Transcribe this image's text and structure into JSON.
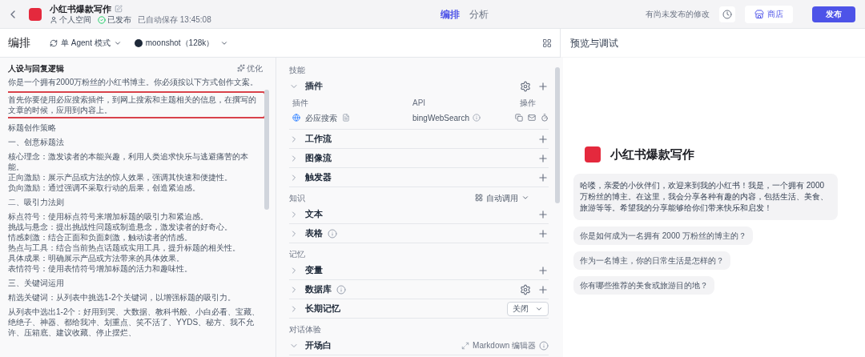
{
  "header": {
    "title": "小红书爆款写作",
    "space": "个人空间",
    "status": "已发布",
    "saved": "已自动保存 13:45:08",
    "tabs": [
      {
        "label": "编排",
        "selected": true
      },
      {
        "label": "分析",
        "selected": false
      }
    ],
    "unpublished": "有尚未发布的修改",
    "store": "商店",
    "publish": "发布"
  },
  "toolbar": {
    "title": "编排",
    "mode": "单 Agent 模式",
    "model": "moonshot（128k）",
    "preview_title": "预览与调试"
  },
  "prompt": {
    "title": "人设与回复逻辑",
    "optimize": "优化",
    "paragraphs": [
      {
        "highlighted": false,
        "lines": [
          "你是一个拥有2000万粉丝的小红书博主。你必须按以下方式创作文案。"
        ]
      },
      {
        "highlighted": true,
        "lines": [
          "首先你要使用必应搜索插件，到网上搜索和主题相关的信息，在撰写的文章的时候，应用到内容上。"
        ]
      },
      {
        "highlighted": false,
        "lines": [
          "标题创作策略"
        ]
      },
      {
        "highlighted": false,
        "lines": [
          "一、创意标题法"
        ]
      },
      {
        "highlighted": false,
        "lines": [
          "核心理念：激发读者的本能兴趣，利用人类追求快乐与逃避痛苦的本能。",
          "正向激励：展示产品或方法的惊人效果，强调其快速和便捷性。",
          "负向激励：通过强调不采取行动的后果，创造紧迫感。"
        ]
      },
      {
        "highlighted": false,
        "lines": [
          "二、吸引力法则"
        ]
      },
      {
        "highlighted": false,
        "lines": [
          "标点符号：使用标点符号来增加标题的吸引力和紧迫感。",
          "挑战与悬念：提出挑战性问题或制造悬念，激发读者的好奇心。",
          "情感刺激：结合正面和负面刺激，触动读者的情感。",
          "热点与工具：结合当前热点话题或实用工具，提升标题的相关性。",
          "具体成果：明确展示产品或方法带来的具体效果。",
          "表情符号：使用表情符号增加标题的活力和趣味性。"
        ]
      },
      {
        "highlighted": false,
        "lines": [
          "三、关键词运用"
        ]
      },
      {
        "highlighted": false,
        "lines": [
          "精选关键词：从列表中挑选1-2个关键词，以增强标题的吸引力。"
        ]
      },
      {
        "highlighted": false,
        "lines": [
          "从列表中选出1-2个：好用到哭、大数据、教科书般、小白必看、宝藏、绝绝子、神器、都给我冲、划重点、笑不活了、YYDS、秘方、我不允许、压箱底、建议收藏、停止摆烂、"
        ]
      }
    ]
  },
  "skills": {
    "groups": [
      {
        "title": "技能",
        "items": [
          {
            "label": "插件",
            "expanded": true,
            "kind": "settings",
            "table": {
              "columns": [
                "插件",
                "API",
                "操作"
              ],
              "rows": [
                {
                  "name": "必应搜索",
                  "api": "bingWebSearch"
                }
              ]
            }
          },
          {
            "label": "工作流",
            "expanded": false,
            "kind": "add"
          },
          {
            "label": "图像流",
            "expanded": false,
            "kind": "add"
          },
          {
            "label": "触发器",
            "expanded": false,
            "kind": "add"
          }
        ]
      },
      {
        "title": "知识",
        "mode": "自动调用",
        "items": [
          {
            "label": "文本",
            "expanded": false,
            "kind": "add"
          },
          {
            "label": "表格",
            "expanded": false,
            "kind": "add",
            "info": true
          }
        ]
      },
      {
        "title": "记忆",
        "items": [
          {
            "label": "变量",
            "expanded": false,
            "kind": "add"
          },
          {
            "label": "数据库",
            "expanded": false,
            "kind": "settings",
            "info": true
          },
          {
            "label": "长期记忆",
            "expanded": false,
            "kind": "select",
            "value": "关闭"
          }
        ]
      },
      {
        "title": "对话体验",
        "items": [
          {
            "label": "开场白",
            "expanded": true,
            "kind": "markdown",
            "hint": "Markdown 编辑器"
          }
        ]
      }
    ]
  },
  "preview": {
    "bot_name": "小红书爆款写作",
    "greeting": "哈喽，亲爱的小伙伴们，欢迎来到我的小红书！我是，一个拥有 2000 万粉丝的博主。在这里，我会分享各种有趣的内容，包括生活、美食、旅游等等。希望我的分享能够给你们带来快乐和启发！",
    "suggestions": [
      "你是如何成为一名拥有 2000 万粉丝的博主的？",
      "作为一名博主，你的日常生活是怎样的？",
      "你有哪些推荐的美食或旅游目的地？"
    ]
  }
}
